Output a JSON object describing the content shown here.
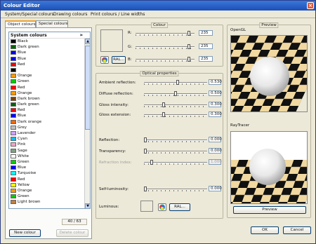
{
  "window": {
    "title": "Colour Editor",
    "close": "×"
  },
  "menu": [
    "System/Special colours",
    "Drawing colours",
    "Print colours / Line widths"
  ],
  "tabs": [
    "Object colours",
    "Special colours"
  ],
  "list": {
    "header": "System colours",
    "collapse_glyph": "»",
    "items": [
      {
        "name": "Black",
        "color": "#000000"
      },
      {
        "name": "Dark green",
        "color": "#006400"
      },
      {
        "name": "Blue",
        "color": "#0000ff"
      },
      {
        "name": "Blue",
        "color": "#0000ff"
      },
      {
        "name": "Red",
        "color": "#ff0000"
      },
      {
        "name": "",
        "color": "#000000"
      },
      {
        "name": "Orange",
        "color": "#ff9900"
      },
      {
        "name": "Green",
        "color": "#00cc00"
      },
      {
        "name": "Red",
        "color": "#ff0000"
      },
      {
        "name": "Orange",
        "color": "#ff9900"
      },
      {
        "name": "Dark brown",
        "color": "#804000"
      },
      {
        "name": "Dark green",
        "color": "#006400"
      },
      {
        "name": "Red",
        "color": "#ff0000"
      },
      {
        "name": "Blue",
        "color": "#0000ff"
      },
      {
        "name": "Dark orange",
        "color": "#ff6600"
      },
      {
        "name": "Grey",
        "color": "#c0c0c0"
      },
      {
        "name": "Lavender",
        "color": "#d0a0ff"
      },
      {
        "name": "Cyan",
        "color": "#00c0ff"
      },
      {
        "name": "Pink",
        "color": "#ffa0c8"
      },
      {
        "name": "Sage",
        "color": "#80a080"
      },
      {
        "name": "White",
        "color": "#ffffff"
      },
      {
        "name": "Green",
        "color": "#00cc00"
      },
      {
        "name": "Blue",
        "color": "#0000ff"
      },
      {
        "name": "Turquoise",
        "color": "#00ffff"
      },
      {
        "name": "Red",
        "color": "#ff0000"
      },
      {
        "name": "Yellow",
        "color": "#ffff00"
      },
      {
        "name": "Orange",
        "color": "#ff9900"
      },
      {
        "name": "Green",
        "color": "#00cc00"
      },
      {
        "name": "Light brown",
        "color": "#c08040"
      }
    ],
    "counter": "40 / 63"
  },
  "buttons": {
    "new_colour": "New colour",
    "delete_colour": "Delete colour",
    "ok": "OK",
    "cancel": "Cancel",
    "preview": "Preview",
    "ral": "RAL...",
    "ral2": "RAL..."
  },
  "colour": {
    "title": "Colour",
    "r_label": "R:",
    "g_label": "G:",
    "b_label": "B:",
    "r": "235",
    "g": "235",
    "b": "235",
    "r_level": 0.92,
    "g_level": 0.92,
    "b_level": 0.92
  },
  "optical": {
    "title": "Optical properties",
    "rows": [
      {
        "label": "Ambient reflection:",
        "value": "0.530",
        "level": 0.53,
        "disabled": false
      },
      {
        "label": "Diffuse reflection:",
        "value": "0.500",
        "level": 0.5,
        "disabled": false
      },
      {
        "label": "Gloss intensity:",
        "value": "0.300",
        "level": 0.3,
        "disabled": false
      },
      {
        "label": "Gloss extension:",
        "value": "0.300",
        "level": 0.3,
        "disabled": false
      },
      {
        "label": "Reflection:",
        "value": "0.000",
        "level": 0,
        "disabled": false
      },
      {
        "label": "Transparency:",
        "value": "0.000",
        "level": 0,
        "disabled": false
      },
      {
        "label": "Refraction index:",
        "value": "1.000",
        "level": 0.1,
        "disabled": true
      },
      {
        "label": "Self-luminosity:",
        "value": "0.000",
        "level": 0,
        "disabled": false
      }
    ],
    "luminous_label": "Luminous:"
  },
  "preview": {
    "title": "Preview",
    "opengl_label": "OpenGL",
    "raytracer_label": "RayTracer"
  }
}
